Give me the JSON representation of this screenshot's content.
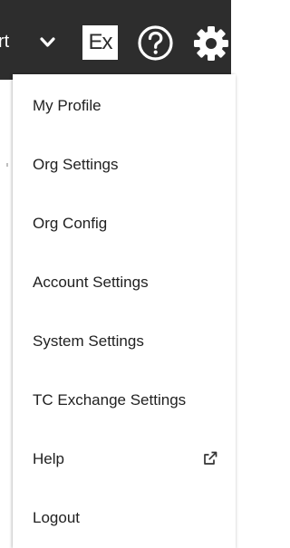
{
  "header": {
    "nav_label": "rt",
    "ex_icon_text": "Ex",
    "icons": [
      "chevron-down-icon",
      "ex-icon",
      "help-icon",
      "gear-icon"
    ]
  },
  "menu": {
    "items": [
      {
        "label": "My Profile"
      },
      {
        "label": "Org Settings"
      },
      {
        "label": "Org Config"
      },
      {
        "label": "Account Settings"
      },
      {
        "label": "System Settings"
      },
      {
        "label": "TC Exchange Settings"
      },
      {
        "label": "Help",
        "icon": "external-link-icon"
      },
      {
        "label": "Logout"
      }
    ]
  },
  "colors": {
    "header_bg": "#2d2d2d",
    "menu_bg": "#ffffff",
    "text": "#212121"
  }
}
